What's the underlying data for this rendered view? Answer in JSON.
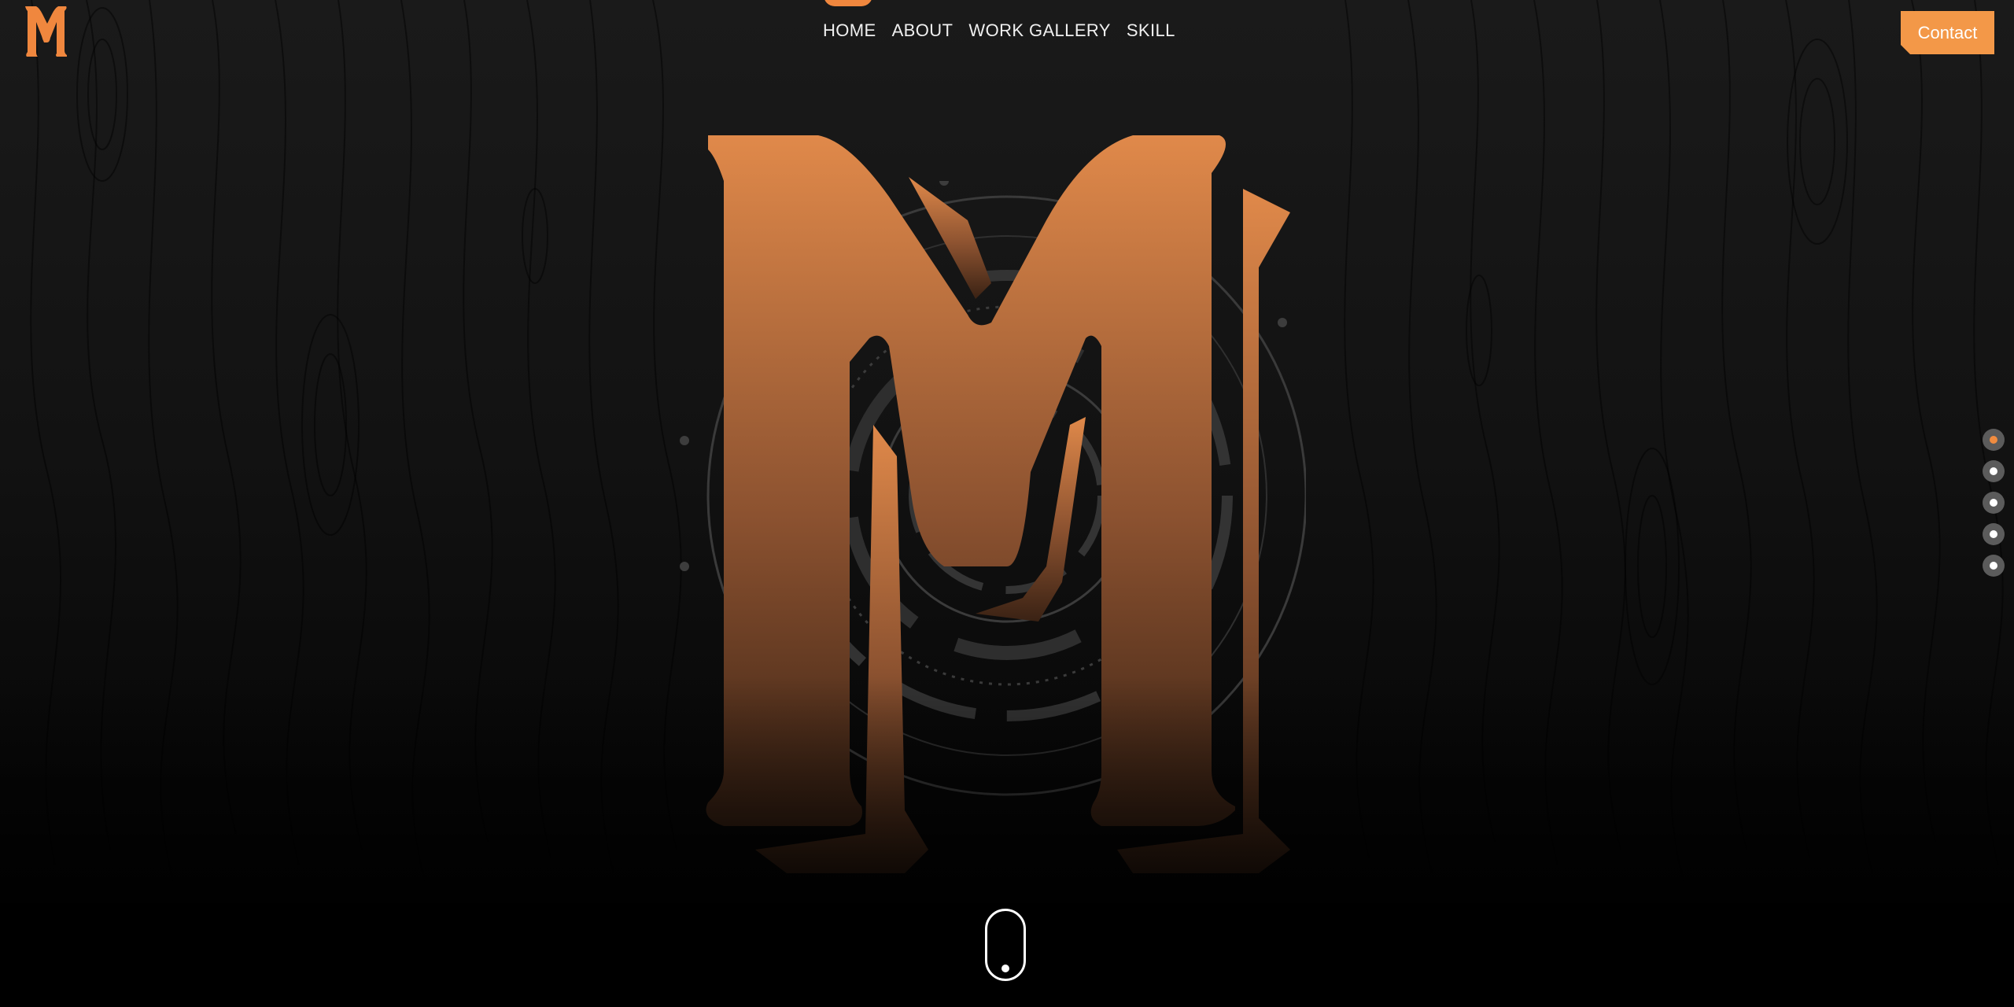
{
  "app": {
    "brand_letter": "M",
    "accent_color": "#f39848"
  },
  "nav": {
    "items": [
      {
        "label": "HOME",
        "active": true
      },
      {
        "label": "ABOUT",
        "active": false
      },
      {
        "label": "WORK GALLERY",
        "active": false
      },
      {
        "label": "SKILL",
        "active": false
      }
    ]
  },
  "header": {
    "contact_label": "Contact"
  },
  "section_dots": {
    "count": 5,
    "active_index": 0
  },
  "icons": {
    "logo": "m-logo-icon",
    "hero": "m-monogram-icon",
    "scroll": "mouse-scroll-icon"
  }
}
